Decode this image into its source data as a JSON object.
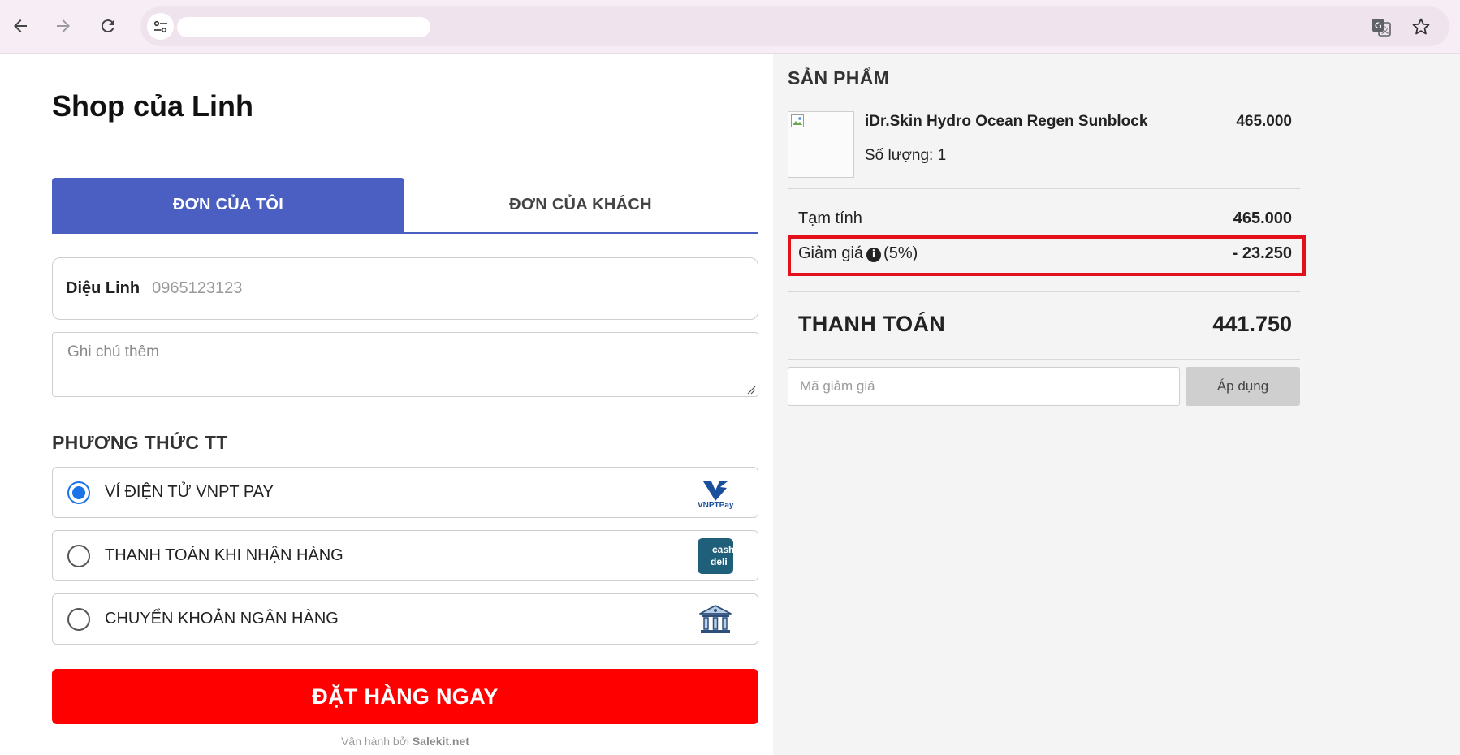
{
  "browser": {
    "url_display": ""
  },
  "shop": {
    "title": "Shop của Linh"
  },
  "tabs": [
    {
      "label": "ĐƠN CỦA TÔI",
      "active": true
    },
    {
      "label": "ĐƠN CỦA KHÁCH",
      "active": false
    }
  ],
  "customer": {
    "name": "Diệu Linh",
    "phone": "0965123123"
  },
  "note": {
    "placeholder": "Ghi chú thêm"
  },
  "payment": {
    "heading": "PHƯƠNG THỨC TT",
    "options": [
      {
        "label": "VÍ ĐIỆN TỬ VNPT PAY",
        "checked": true,
        "icon": "vnpt-pay-logo",
        "icon_text": "VNPTPay"
      },
      {
        "label": "THANH TOÁN KHI NHẬN HÀNG",
        "checked": false,
        "icon": "cash-on-delivery-icon",
        "icon_text": "cash deli"
      },
      {
        "label": "CHUYỂN KHOẢN NGÂN HÀNG",
        "checked": false,
        "icon": "bank-icon"
      }
    ]
  },
  "order_button": {
    "label": "ĐẶT HÀNG NGAY",
    "color": "#ff0000"
  },
  "footer": {
    "prefix": "Vận hành bởi",
    "brand": "Salekit.net"
  },
  "products": {
    "heading": "SẢN PHẨM",
    "items": [
      {
        "name": "iDr.Skin Hydro Ocean Regen Sunblock",
        "price": "465.000",
        "qty_label": "Số lượng: 1"
      }
    ]
  },
  "summary": {
    "subtotal_label": "Tạm tính",
    "subtotal_value": "465.000",
    "discount_label": "Giảm giá",
    "discount_percent": "(5%)",
    "discount_value": "- 23.250",
    "total_label": "THANH TOÁN",
    "total_value": "441.750"
  },
  "coupon": {
    "placeholder": "Mã giảm giá",
    "apply_label": "Áp dụng"
  },
  "colors": {
    "tab_active": "#4a5fc1",
    "highlight": "#e3101b",
    "radio_checked": "#1a73e8"
  }
}
